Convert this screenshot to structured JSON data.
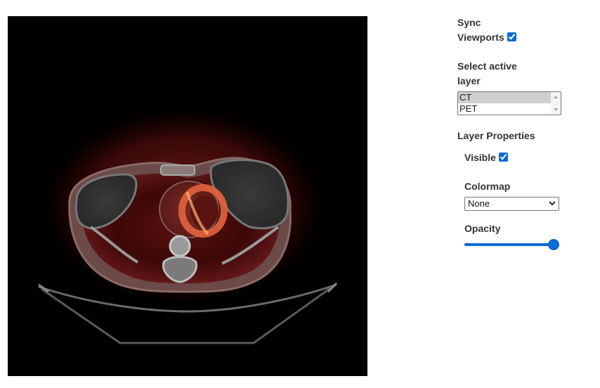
{
  "sync": {
    "label_line1": "Sync",
    "label_line2": "Viewports",
    "checked": true
  },
  "layer_select": {
    "label_line1": "Select active",
    "label_line2": "layer",
    "options": [
      "CT",
      "PET"
    ],
    "selected": "CT"
  },
  "layer_properties": {
    "title": "Layer Properties",
    "visible_label": "Visible",
    "visible_checked": true,
    "colormap_label": "Colormap",
    "colormap_value": "None",
    "opacity_label": "Opacity",
    "opacity_value": 1.0
  },
  "colors": {
    "accent": "#0b6bd6",
    "viewport_background": "#000000"
  },
  "viewport": {
    "image": "fused-ct-pet-axial-chest-slice"
  }
}
